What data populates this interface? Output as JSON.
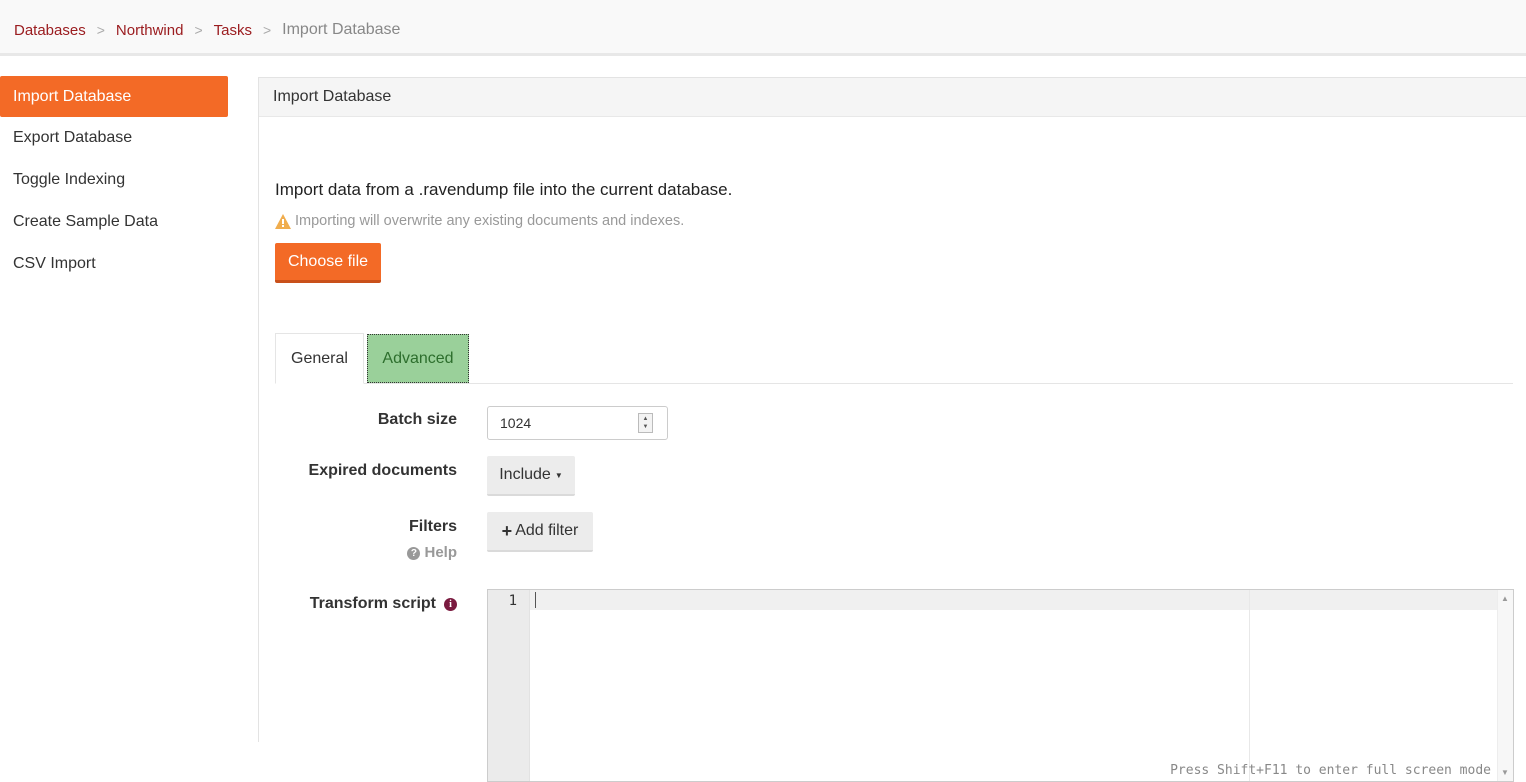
{
  "breadcrumb": {
    "items": [
      "Databases",
      "Northwind",
      "Tasks"
    ],
    "separator": ">",
    "current": "Import Database"
  },
  "sidebar": {
    "items": [
      {
        "label": "Import Database",
        "active": true
      },
      {
        "label": "Export Database"
      },
      {
        "label": "Toggle Indexing"
      },
      {
        "label": "Create Sample Data"
      },
      {
        "label": "CSV Import"
      }
    ]
  },
  "panel": {
    "title": "Import Database",
    "intro": "Import data from a .ravendump file into the current database.",
    "warning": "Importing will overwrite any existing documents and indexes.",
    "choose_file": "Choose file"
  },
  "tabs": [
    {
      "label": "General"
    },
    {
      "label": "Advanced",
      "active": true
    }
  ],
  "form": {
    "batch_size_label": "Batch size",
    "batch_size_value": "1024",
    "expired_label": "Expired documents",
    "expired_value": "Include",
    "filters_label": "Filters",
    "help_label": "Help",
    "add_filter": "Add filter",
    "transform_label": "Transform script"
  },
  "editor": {
    "line_number": "1",
    "fullscreen_hint": "Press Shift+F11 to enter full screen mode"
  },
  "colors": {
    "accent": "#f36a26",
    "breadcrumb_link": "#9b1d20",
    "advanced_tab": "#9ad09a",
    "warning": "#f0ad4e"
  }
}
